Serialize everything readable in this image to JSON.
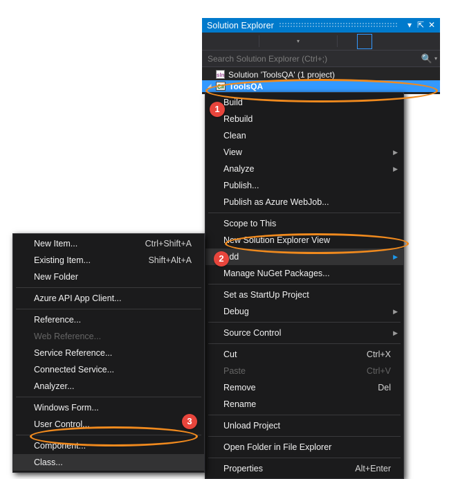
{
  "solution_explorer": {
    "title": "Solution Explorer",
    "title_buttons": [
      {
        "name": "dropdown",
        "glyph": "▾"
      },
      {
        "name": "pin",
        "glyph": "⇱"
      },
      {
        "name": "close",
        "glyph": "✕"
      }
    ],
    "toolbar": {
      "caret_glyph": "▾"
    },
    "search": {
      "placeholder": "Search Solution Explorer (Ctrl+;)",
      "icon": "search-icon",
      "icon_glyph": "🔍",
      "caret_glyph": "▾"
    },
    "tree": [
      {
        "label": "Solution 'ToolsQA' (1 project)",
        "icon": "solution-icon",
        "icon_text": "sln",
        "selected": false,
        "arrow": ""
      },
      {
        "label": "ToolsQA",
        "icon": "csharp-project-icon",
        "icon_text": "C#",
        "selected": true,
        "arrow": "◢"
      }
    ]
  },
  "project_context_menu": {
    "items": [
      {
        "label": "Build",
        "accel": "",
        "arrow": "",
        "type": "item"
      },
      {
        "label": "Rebuild",
        "accel": "",
        "arrow": "",
        "type": "item"
      },
      {
        "label": "Clean",
        "accel": "",
        "arrow": "",
        "type": "item"
      },
      {
        "label": "View",
        "accel": "",
        "arrow": "▶",
        "type": "item"
      },
      {
        "label": "Analyze",
        "accel": "",
        "arrow": "▶",
        "type": "item"
      },
      {
        "label": "Publish...",
        "accel": "",
        "arrow": "",
        "type": "item"
      },
      {
        "label": "Publish as Azure WebJob...",
        "accel": "",
        "arrow": "",
        "type": "item"
      },
      {
        "type": "separator"
      },
      {
        "label": "Scope to This",
        "accel": "",
        "arrow": "",
        "type": "item"
      },
      {
        "label": "New Solution Explorer View",
        "accel": "",
        "arrow": "",
        "type": "item"
      },
      {
        "label": "Add",
        "accel": "",
        "arrow": "▶",
        "type": "item",
        "hovered": true,
        "arrow_active": true
      },
      {
        "label": "Manage NuGet Packages...",
        "accel": "",
        "arrow": "",
        "type": "item"
      },
      {
        "type": "separator"
      },
      {
        "label": "Set as StartUp Project",
        "accel": "",
        "arrow": "",
        "type": "item"
      },
      {
        "label": "Debug",
        "accel": "",
        "arrow": "▶",
        "type": "item"
      },
      {
        "type": "separator"
      },
      {
        "label": "Source Control",
        "accel": "",
        "arrow": "▶",
        "type": "item"
      },
      {
        "type": "separator"
      },
      {
        "label": "Cut",
        "accel": "Ctrl+X",
        "arrow": "",
        "type": "item"
      },
      {
        "label": "Paste",
        "accel": "Ctrl+V",
        "arrow": "",
        "type": "item",
        "disabled": true
      },
      {
        "label": "Remove",
        "accel": "Del",
        "arrow": "",
        "type": "item"
      },
      {
        "label": "Rename",
        "accel": "",
        "arrow": "",
        "type": "item"
      },
      {
        "type": "separator"
      },
      {
        "label": "Unload Project",
        "accel": "",
        "arrow": "",
        "type": "item"
      },
      {
        "type": "separator"
      },
      {
        "label": "Open Folder in File Explorer",
        "accel": "",
        "arrow": "",
        "type": "item"
      },
      {
        "type": "separator"
      },
      {
        "label": "Properties",
        "accel": "Alt+Enter",
        "arrow": "",
        "type": "item"
      }
    ]
  },
  "add_submenu": {
    "items": [
      {
        "label": "New Item...",
        "accel": "Ctrl+Shift+A",
        "type": "item"
      },
      {
        "label": "Existing Item...",
        "accel": "Shift+Alt+A",
        "type": "item"
      },
      {
        "label": "New Folder",
        "accel": "",
        "type": "item"
      },
      {
        "type": "separator"
      },
      {
        "label": "Azure API App Client...",
        "accel": "",
        "type": "item"
      },
      {
        "type": "separator"
      },
      {
        "label": "Reference...",
        "accel": "",
        "type": "item"
      },
      {
        "label": "Web Reference...",
        "accel": "",
        "type": "item",
        "disabled": true
      },
      {
        "label": "Service Reference...",
        "accel": "",
        "type": "item"
      },
      {
        "label": "Connected Service...",
        "accel": "",
        "type": "item"
      },
      {
        "label": "Analyzer...",
        "accel": "",
        "type": "item"
      },
      {
        "type": "separator"
      },
      {
        "label": "Windows Form...",
        "accel": "",
        "type": "item"
      },
      {
        "label": "User Control...",
        "accel": "",
        "type": "item"
      },
      {
        "type": "separator"
      },
      {
        "label": "Component...",
        "accel": "",
        "type": "item"
      },
      {
        "label": "Class...",
        "accel": "",
        "type": "item",
        "hovered": true
      }
    ]
  },
  "annotations": {
    "accent_color": "#f08a1e",
    "badge_color": "#e8453c",
    "badges": [
      {
        "number": "1",
        "target": "ToolsQA project node"
      },
      {
        "number": "2",
        "target": "Add menu item"
      },
      {
        "number": "3",
        "target": "Class... menu item"
      }
    ]
  }
}
